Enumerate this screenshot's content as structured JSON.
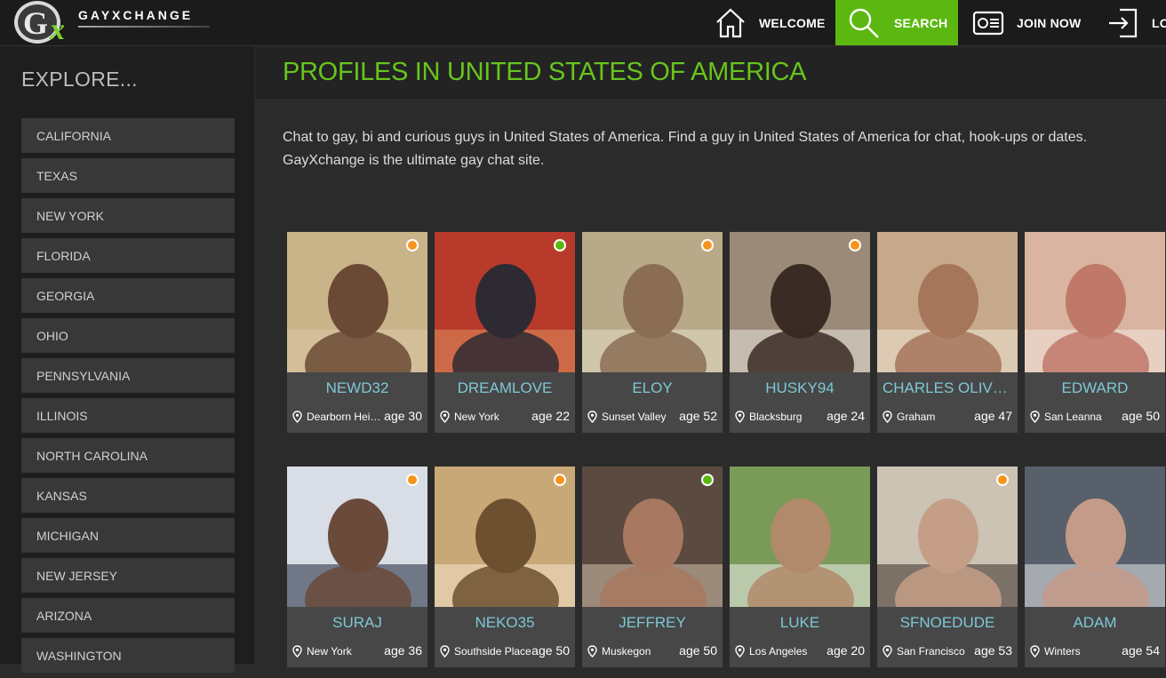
{
  "brand": {
    "logo_text": "GAYXCHANGE",
    "accent": "#5cb811",
    "title_color": "#68c51d",
    "name_color": "#7ec8d6"
  },
  "nav": {
    "welcome": "WELCOME",
    "search": "SEARCH",
    "join": "JOIN NOW",
    "login": "LO"
  },
  "sidebar": {
    "title": "EXPLORE...",
    "items": [
      {
        "label": "CALIFORNIA"
      },
      {
        "label": "TEXAS"
      },
      {
        "label": "NEW YORK"
      },
      {
        "label": "FLORIDA"
      },
      {
        "label": "GEORGIA"
      },
      {
        "label": "OHIO"
      },
      {
        "label": "PENNSYLVANIA"
      },
      {
        "label": "ILLINOIS"
      },
      {
        "label": "NORTH CAROLINA"
      },
      {
        "label": "KANSAS"
      },
      {
        "label": "MICHIGAN"
      },
      {
        "label": "NEW JERSEY"
      },
      {
        "label": "ARIZONA"
      },
      {
        "label": "WASHINGTON"
      }
    ]
  },
  "main": {
    "title": "PROFILES IN UNITED STATES OF AMERICA",
    "intro": "Chat to gay, bi and curious guys in United States of America. Find a guy in United States of America for chat, hook-ups or dates. GayXchange is the ultimate gay chat site."
  },
  "profiles": [
    {
      "name": "NEWD32",
      "location": "Dearborn Heights",
      "age": "age 30",
      "status": "orange",
      "photo": "photo-newd32"
    },
    {
      "name": "DREAMLOVE",
      "location": "New York",
      "age": "age 22",
      "status": "green",
      "photo": "photo-dreamlove"
    },
    {
      "name": "ELOY",
      "location": "Sunset Valley",
      "age": "age 52",
      "status": "orange",
      "photo": "photo-eloy"
    },
    {
      "name": "HUSKY94",
      "location": "Blacksburg",
      "age": "age 24",
      "status": "orange",
      "photo": "photo-husky94"
    },
    {
      "name": "CHARLES OLIVER...",
      "location": "Graham",
      "age": "age 47",
      "status": "none",
      "photo": "photo-charles"
    },
    {
      "name": "EDWARD",
      "location": "San Leanna",
      "age": "age 50",
      "status": "none",
      "photo": "photo-edward"
    },
    {
      "name": "SURAJ",
      "location": "New York",
      "age": "age 36",
      "status": "orange",
      "photo": "photo-suraj"
    },
    {
      "name": "NEKO35",
      "location": "Southside Place",
      "age": "age 50",
      "status": "orange",
      "photo": "photo-neko35"
    },
    {
      "name": "JEFFREY",
      "location": "Muskegon",
      "age": "age 50",
      "status": "green",
      "photo": "photo-jeffrey"
    },
    {
      "name": "LUKE",
      "location": "Los Angeles",
      "age": "age 20",
      "status": "none",
      "photo": "photo-luke"
    },
    {
      "name": "SFNOEDUDE",
      "location": "San Francisco",
      "age": "age 53",
      "status": "orange",
      "photo": "photo-sfnoedude"
    },
    {
      "name": "ADAM",
      "location": "Winters",
      "age": "age 54",
      "status": "none",
      "photo": "photo-adam"
    }
  ],
  "status_colors": {
    "orange": "#f7941d",
    "green": "#5cb811"
  }
}
